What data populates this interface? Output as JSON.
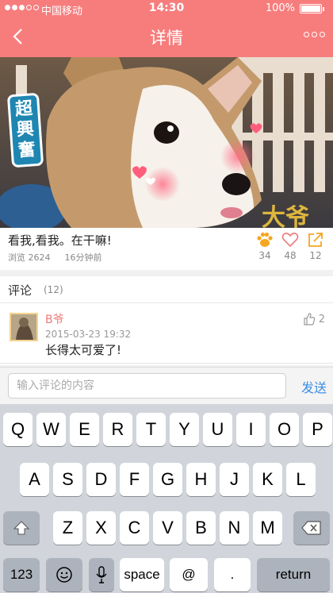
{
  "status_bar": {
    "carrier": "中国移动",
    "time": "14:30",
    "battery": "100%"
  },
  "nav": {
    "title": "详情",
    "back_icon": "chevron-left-icon",
    "more_icon": "more-dots-icon"
  },
  "photo": {
    "sticker_text": "超興奮"
  },
  "post": {
    "text": "看我,看我。在干嘛!",
    "views": "浏览 2624",
    "time_ago": "16分钟前",
    "paw_count": "34",
    "like_count": "48",
    "share_count": "12"
  },
  "comments": {
    "title": "评论",
    "count": "(12)",
    "items": [
      {
        "user": "B爷",
        "time": "2015-03-23  19:32",
        "body": "长得太可爱了!",
        "likes": "2"
      }
    ]
  },
  "input_bar": {
    "placeholder": "输入评论的内容",
    "send_label": "发送"
  },
  "keyboard": {
    "row1": [
      "Q",
      "W",
      "E",
      "R",
      "T",
      "Y",
      "U",
      "I",
      "O",
      "P"
    ],
    "row2": [
      "A",
      "S",
      "D",
      "F",
      "G",
      "H",
      "J",
      "K",
      "L"
    ],
    "row3": [
      "Z",
      "X",
      "C",
      "V",
      "B",
      "N",
      "M"
    ],
    "num_label": "123",
    "space_label": "space",
    "at_label": "@",
    "dot_label": ".",
    "return_label": "return"
  },
  "colors": {
    "accent": "#f77d7d",
    "link": "#3a8ee6",
    "paw": "#f5a623"
  }
}
